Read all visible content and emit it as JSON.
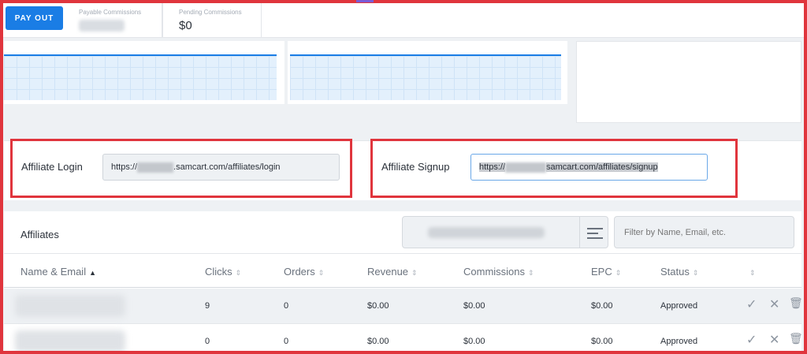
{
  "stats": {
    "payout_label": "PAY OUT",
    "payable_label": "Payable Commissions",
    "pending_label": "Pending Commissions",
    "pending_value": "$0"
  },
  "links": {
    "login_label": "Affiliate Login",
    "login_prefix": "https://",
    "login_suffix": ".samcart.com/affiliates/login",
    "signup_label": "Affiliate Signup",
    "signup_prefix": "https://",
    "signup_suffix": "samcart.com/affiliates/signup"
  },
  "affiliates": {
    "title": "Affiliates",
    "filter_placeholder": "Filter by Name, Email, etc.",
    "columns": {
      "name": "Name & Email",
      "clicks": "Clicks",
      "orders": "Orders",
      "revenue": "Revenue",
      "commissions": "Commissions",
      "epc": "EPC",
      "status": "Status"
    },
    "rows": [
      {
        "clicks": "9",
        "orders": "0",
        "revenue": "$0.00",
        "commissions": "$0.00",
        "epc": "$0.00",
        "status": "Approved"
      },
      {
        "clicks": "0",
        "orders": "0",
        "revenue": "$0.00",
        "commissions": "$0.00",
        "epc": "$0.00",
        "status": "Approved"
      }
    ]
  },
  "icons": {
    "sort_asc": "▲",
    "sort_both": "⇕",
    "approve": "✓",
    "reject": "✕",
    "delete": "🗑"
  },
  "colors": {
    "accent": "#1a7de5",
    "highlight": "#e0353d"
  }
}
